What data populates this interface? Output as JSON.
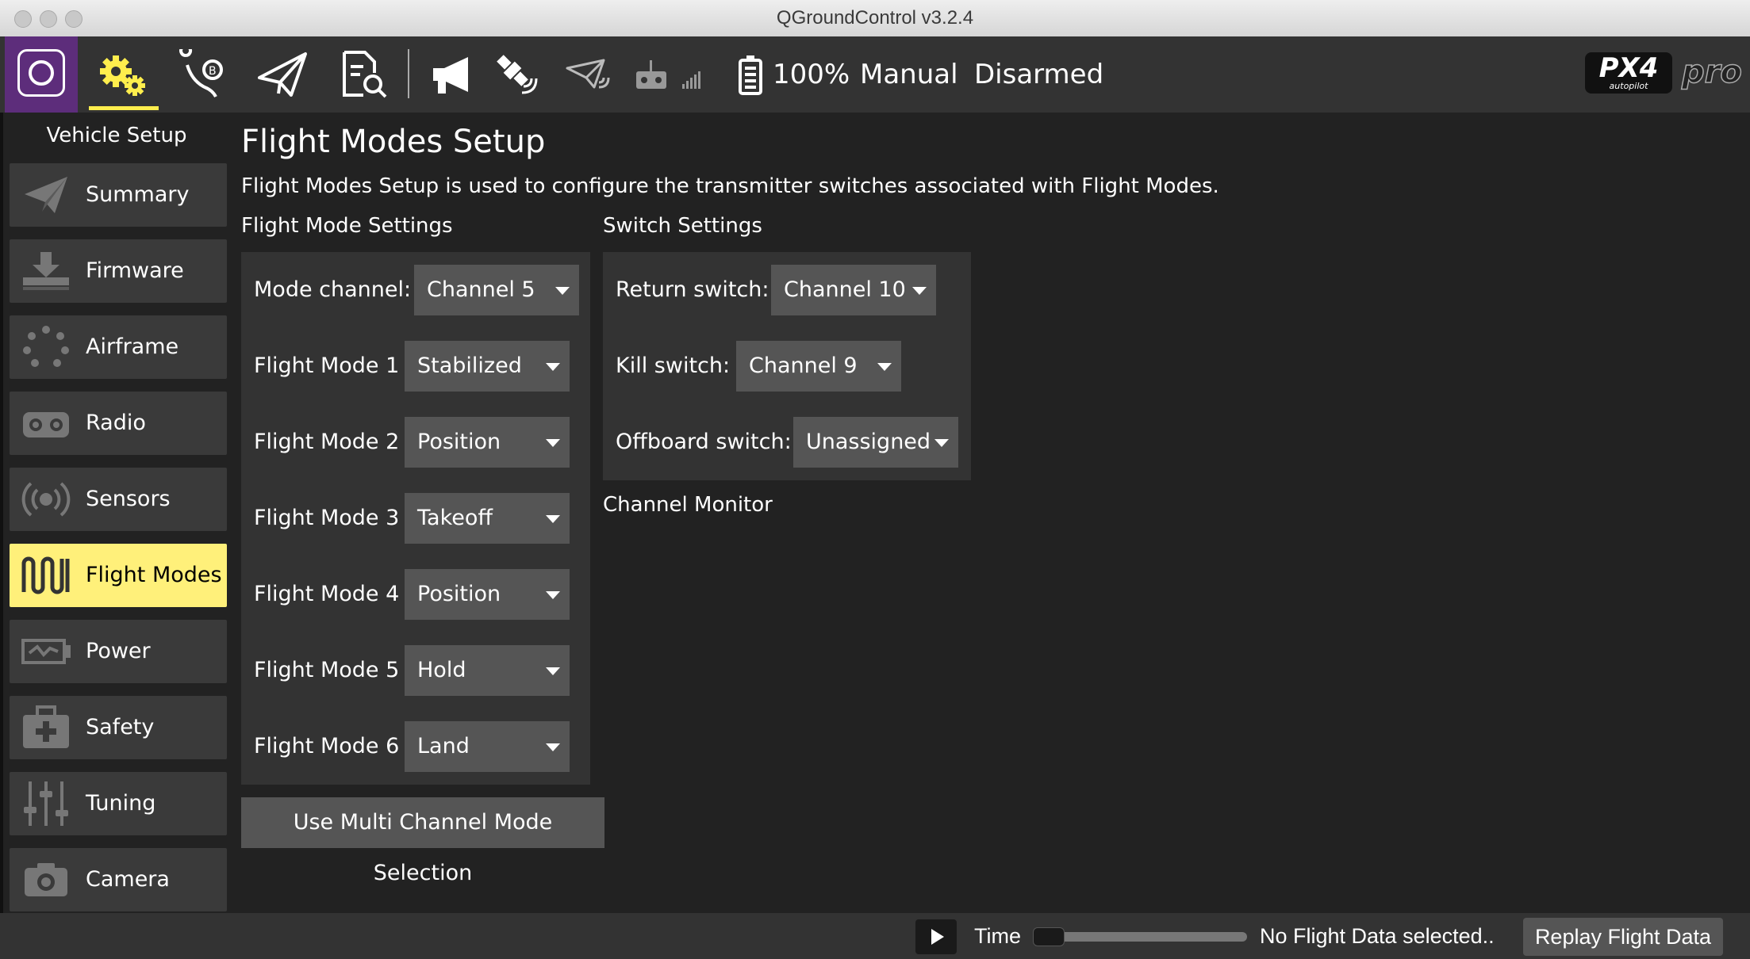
{
  "window": {
    "title": "QGroundControl v3.2.4"
  },
  "toolbar": {
    "battery_percent": "100%",
    "flight_mode": "Manual",
    "arm_state": "Disarmed",
    "brand_logo": "PX4 autopilot",
    "brand_pro": "pro",
    "icons": [
      "qgc-logo-icon",
      "vehicle-setup-gear-icon",
      "plan-view-icon",
      "fly-view-icon",
      "analyze-view-icon",
      "messages-megaphone-icon",
      "gps-satellite-icon",
      "telemetry-rssi-icon",
      "rc-rssi-icon",
      "battery-icon"
    ]
  },
  "sidebar": {
    "title": "Vehicle Setup",
    "items": [
      {
        "label": "Summary",
        "icon": "paper-plane-icon",
        "active": false
      },
      {
        "label": "Firmware",
        "icon": "download-icon",
        "active": false
      },
      {
        "label": "Airframe",
        "icon": "airframe-dots-icon",
        "active": false
      },
      {
        "label": "Radio",
        "icon": "radio-transmitter-icon",
        "active": false
      },
      {
        "label": "Sensors",
        "icon": "sensors-broadcast-icon",
        "active": false
      },
      {
        "label": "Flight Modes",
        "icon": "flight-modes-wave-icon",
        "active": true
      },
      {
        "label": "Power",
        "icon": "power-battery-icon",
        "active": false
      },
      {
        "label": "Safety",
        "icon": "safety-medkit-icon",
        "active": false
      },
      {
        "label": "Tuning",
        "icon": "tuning-sliders-icon",
        "active": false
      },
      {
        "label": "Camera",
        "icon": "camera-icon",
        "active": false
      }
    ],
    "active_color": "#fff07a"
  },
  "main": {
    "title": "Flight Modes Setup",
    "description": "Flight Modes Setup is used to configure the transmitter switches associated with Flight Modes.",
    "flight_mode_settings": {
      "heading": "Flight Mode Settings",
      "mode_channel_label": "Mode channel:",
      "mode_channel_value": "Channel 5",
      "modes": [
        {
          "label": "Flight Mode 1",
          "value": "Stabilized"
        },
        {
          "label": "Flight Mode 2",
          "value": "Position"
        },
        {
          "label": "Flight Mode 3",
          "value": "Takeoff"
        },
        {
          "label": "Flight Mode 4",
          "value": "Position"
        },
        {
          "label": "Flight Mode 5",
          "value": "Hold"
        },
        {
          "label": "Flight Mode 6",
          "value": "Land"
        }
      ]
    },
    "switch_settings": {
      "heading": "Switch Settings",
      "switches": [
        {
          "label": "Return switch:",
          "value": "Channel 10"
        },
        {
          "label": "Kill switch:",
          "value": "Channel 9"
        },
        {
          "label": "Offboard switch:",
          "value": "Unassigned"
        }
      ]
    },
    "channel_monitor_heading": "Channel Monitor",
    "multi_channel_button": "Use Multi Channel Mode Selection"
  },
  "bottombar": {
    "time_label": "Time",
    "status": "No Flight Data selected..",
    "replay_button": "Replay Flight Data",
    "playback_progress": 0
  }
}
